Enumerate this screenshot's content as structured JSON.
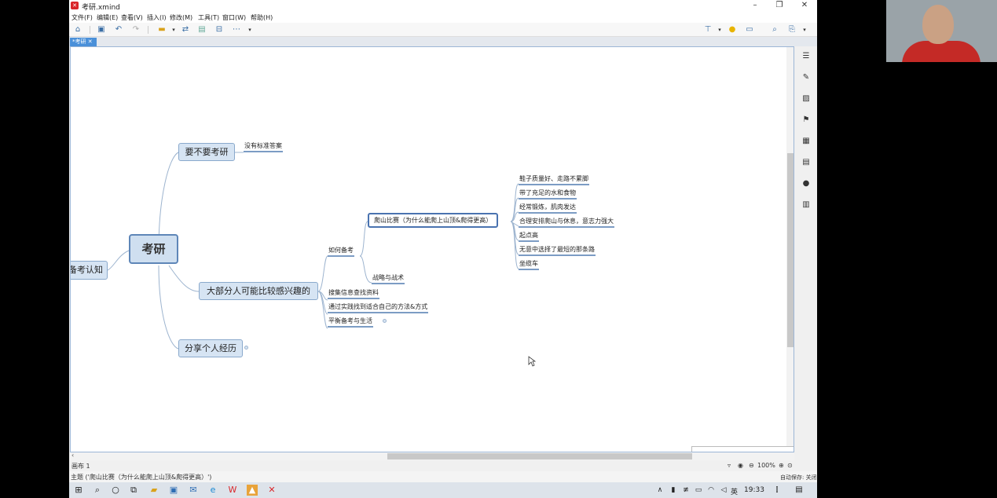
{
  "window": {
    "title": "考研.xmind",
    "app_icon": "xmind-icon",
    "minimize": "–",
    "maximize": "❐",
    "close": "✕"
  },
  "menu": [
    "文件(F)",
    "编辑(E)",
    "查看(V)",
    "插入(I)",
    "修改(M)",
    "工具(T)",
    "窗口(W)",
    "帮助(H)"
  ],
  "tab": {
    "label": "*考研 ✕"
  },
  "mindmap": {
    "central": "考研",
    "left_partial": "备考认知",
    "branches": [
      {
        "label": "要不要考研",
        "children": [
          "没有标准答案"
        ]
      },
      {
        "label": "大部分人可能比较感兴趣的"
      },
      {
        "label": "分享个人经历"
      }
    ],
    "interest": {
      "how": "如何备考",
      "climb": "爬山比赛（为什么能爬上山顶&爬得更高）",
      "climb_children": [
        "鞋子质量好、走路不累脚",
        "带了充足的水和食物",
        "经常锻炼，肌肉发达",
        "合理安排爬山与休息，意志力强大",
        "起点高",
        "无意中选择了最短的那条路",
        "坐缆车"
      ],
      "strategy": "战略与战术",
      "others": [
        "搜集信息查找资料",
        "通过实践找到适合自己的方法&方式",
        "平衡备考与生活"
      ]
    }
  },
  "status": {
    "sheet": "画布 1",
    "zoom": "100%",
    "topic_info": "主题 ('爬山比赛（为什么能爬上山顶&爬得更高）')",
    "autosave": "自动保存: 关闭"
  },
  "taskbar": {
    "lang": "英",
    "time": "19:33"
  }
}
